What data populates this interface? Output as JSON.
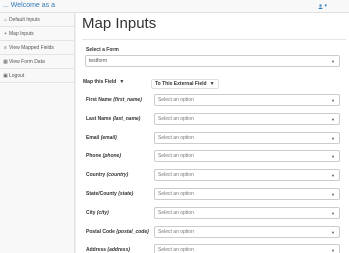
{
  "app": {
    "brand": "... Welcome as a",
    "user_caret": "▾"
  },
  "sidebar": {
    "items": [
      {
        "icon": "home-icon",
        "glyph": "⌂",
        "label": "Default Inputs"
      },
      {
        "icon": "plus-icon",
        "glyph": "+",
        "label": "Map Inputs"
      },
      {
        "icon": "list-icon",
        "glyph": "≡",
        "label": "View Mapped Fields"
      },
      {
        "icon": "table-icon",
        "glyph": "▦",
        "label": "View Form Data"
      },
      {
        "icon": "logout-icon",
        "glyph": "▣",
        "label": "Logout"
      }
    ]
  },
  "main": {
    "title": "Map Inputs",
    "form_label": "Select a Form",
    "form_value": "testform",
    "col_field": "Map this Field",
    "col_external": "To This External Field",
    "col_arrow": "▼",
    "rows": [
      {
        "label": "First Name",
        "key": "(first_name)",
        "placeholder": "Select an option"
      },
      {
        "label": "Last Name",
        "key": "(last_name)",
        "placeholder": "Select an option"
      },
      {
        "label": "Email",
        "key": "(email)",
        "placeholder": "Select an option"
      },
      {
        "label": "Phone",
        "key": "(phone)",
        "placeholder": "Select an option"
      },
      {
        "label": "Country",
        "key": "(country)",
        "placeholder": "Select an option"
      },
      {
        "label": "State/County",
        "key": "(state)",
        "placeholder": "Select an option"
      },
      {
        "label": "City",
        "key": "(city)",
        "placeholder": "Select an option"
      },
      {
        "label": "Postal Code",
        "key": "(postal_code)",
        "placeholder": "Select an option"
      },
      {
        "label": "Address",
        "key": "(address)",
        "placeholder": "Select an option"
      }
    ]
  },
  "colors": {
    "link": "#337ab7",
    "border": "#cccccc",
    "sidebar_bg": "#f8f8f8"
  }
}
